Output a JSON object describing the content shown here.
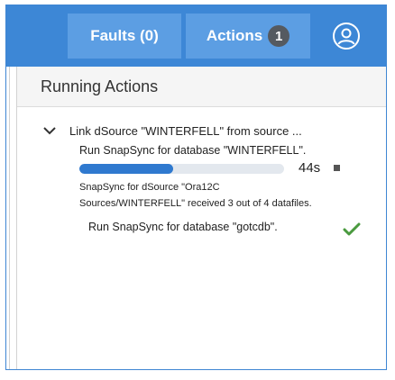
{
  "topbar": {
    "faults_label": "Faults (0)",
    "actions_label": "Actions",
    "actions_count": "1",
    "user_icon": "user-circle-icon"
  },
  "panel": {
    "title": "Running Actions"
  },
  "action": {
    "title": "Link dSource \"WINTERFELL\" from source ...",
    "expand_icon": "chevron-down-icon",
    "steps": [
      {
        "label": "Run SnapSync for database \"WINTERFELL\".",
        "progress": 0.46,
        "elapsed": "44s",
        "detail_line1": "SnapSync for dSource \"Ora12C",
        "detail_line2": "Sources/WINTERFELL\" received 3 out of 4 datafiles."
      },
      {
        "label": "Run SnapSync for database \"gotcdb\".",
        "status_icon": "checkmark-icon",
        "status_color": "#4a9a3f"
      }
    ]
  },
  "colors": {
    "topbar": "#3d87d6",
    "button": "#5c9ee3",
    "badge": "#555a60",
    "progress_fill": "#2f79cf"
  }
}
